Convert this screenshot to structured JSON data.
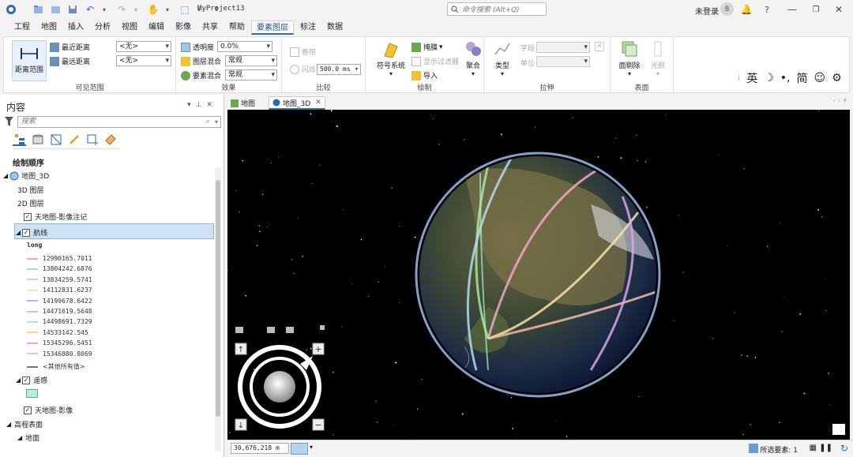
{
  "titlebar": {
    "project_title": "MyProject13",
    "command_search_placeholder": "命令搜索 (Alt+Q)",
    "user_status": "未登录",
    "avatar_glyph": "8",
    "help": "?"
  },
  "menu_tabs": [
    "工程",
    "地图",
    "插入",
    "分析",
    "视图",
    "编辑",
    "影像",
    "共享",
    "帮助",
    "要素图层",
    "标注",
    "数据"
  ],
  "active_menu_tab": "要素图层",
  "ribbon": {
    "visibility_range": {
      "group_label": "可见范围",
      "btn_label": "距离范围",
      "nearest_label": "最近距离",
      "farthest_label": "最远距离",
      "nearest_value": "<无>",
      "farthest_value": "<无>"
    },
    "effects": {
      "group_label": "效果",
      "transparency_label": "透明度",
      "transparency_value": "0.0%",
      "layer_blend_label": "图层混合",
      "layer_blend_value": "常规",
      "feature_blend_label": "要素混合",
      "feature_blend_value": "常规"
    },
    "compare": {
      "group_label": "比较",
      "swipe_label": "卷帘",
      "flash_label": "闪烁",
      "flash_value": "500.0  ms"
    },
    "drawing": {
      "group_label": "绘制",
      "symbology_label": "符号系统",
      "mask_label": "掩膜",
      "show_filter_label": "显示过滤器",
      "import_label": "导入",
      "aggregate_label": "聚合"
    },
    "extrusion": {
      "group_label": "拉伸",
      "type_label": "类型",
      "field_label": "字段",
      "unit_label": "单位"
    },
    "surface": {
      "group_label": "表面",
      "face_cull_label": "面剔除",
      "lighting_label": "光照"
    }
  },
  "contents": {
    "title": "内容",
    "search_placeholder": "搜索",
    "draw_order_label": "绘制顺序",
    "map_name": "地图_3D",
    "layer_3d": "3D 图层",
    "layer_2d": "2D 图层",
    "tianditu_label": "天地图-影像注记",
    "routes_layer": "航线",
    "field_name": "long",
    "legend": [
      {
        "value": "12990165.7011",
        "color": "#f4a6c6"
      },
      {
        "value": "13804242.6876",
        "color": "#a8e6a1"
      },
      {
        "value": "13834259.5741",
        "color": "#b3d9f2"
      },
      {
        "value": "14112831.6237",
        "color": "#f9e3a7"
      },
      {
        "value": "14199678.6422",
        "color": "#b8b4e8"
      },
      {
        "value": "14471619.5648",
        "color": "#f6b9a4"
      },
      {
        "value": "14498691.7329",
        "color": "#a6eec9"
      },
      {
        "value": "14533142.545",
        "color": "#f7d19b"
      },
      {
        "value": "15345296.5451",
        "color": "#d8a6ea"
      },
      {
        "value": "15346880.8069",
        "color": "#d0d0d0"
      }
    ],
    "other_values": "<其他所有值>",
    "remote_layer": "遥感",
    "tianditu_imagery": "天地图-影像",
    "elevation_surfaces": "高程表面",
    "ground": "地面"
  },
  "map_tabs": [
    "地图",
    "地图_3D"
  ],
  "active_map_tab": "地图_3D",
  "statusbar": {
    "scale": "30,676,218 m",
    "selected_features": "所选要素: 1"
  },
  "ime": {
    "lang": "英",
    "moon": "☽",
    "punct": "•,",
    "simp": "简",
    "emoji": "☺",
    "gear": "⚙"
  },
  "colors": {
    "accent": "#2b6cb0",
    "selected_row": "#cde3f5",
    "remote_swatch": "#aef2d8"
  }
}
